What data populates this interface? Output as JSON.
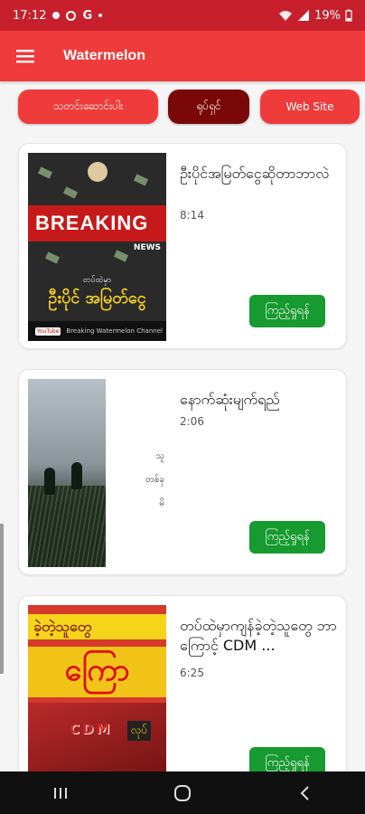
{
  "status_bar": {
    "time": "17:12",
    "battery": "19%",
    "icons": [
      "messenger-icon",
      "ring-icon",
      "google-icon",
      "notification-dot-icon",
      "wifi-icon",
      "signal-icon",
      "battery-icon"
    ]
  },
  "app_bar": {
    "title": "Watermelon",
    "menu_icon": "hamburger-menu-icon"
  },
  "chips": [
    {
      "label": "သတင်းဆောင်းပါး",
      "selected": false
    },
    {
      "label": "ရုပ်ရှင်",
      "selected": true
    },
    {
      "label": "Web Site",
      "selected": false
    }
  ],
  "videos": [
    {
      "title": "ဦးပိုင်အမြတ်ငွေဆိုတာဘာလဲ",
      "duration": "8:14",
      "button": "ကြည့်ရှုရန်",
      "thumb": {
        "headline": "BREAKING",
        "news_tag": "NEWS",
        "subtitle": "တပ်ထဲမှာ",
        "main_text": "ဦးပိုင် အမြတ်ငွေ",
        "footer_logo": "YouTube",
        "footer_text": "Breaking Watermelon Channel"
      }
    },
    {
      "title": "နောက်ဆုံးမျက်ရည်",
      "duration": "2:06",
      "button": "ကြည့်ရှုရန်",
      "thumb": {
        "snippet_lines": [
          "သူ",
          "တစ်ခု",
          "မိ"
        ]
      }
    },
    {
      "title": "တပ်ထဲမှာကျန်ခဲ့တဲ့သူတွေ ဘာကြောင့် CDM ...",
      "duration": "6:25",
      "button": "ကြည့်ရှုရန်",
      "thumb": {
        "top_text": "ခဲ့တဲ့သူတွေ",
        "big_text": "ကြော",
        "cdm_text": "CDM",
        "cdm_box": "လုပ်"
      }
    }
  ],
  "nav_bar": {
    "items": [
      "recent-apps-icon",
      "home-icon",
      "back-icon"
    ]
  },
  "colors": {
    "status_bar": "#c7202c",
    "app_bar": "#ef3b3b",
    "chip_default": "#ef3b3b",
    "chip_selected": "#7a0808",
    "watch_button": "#179a2f"
  }
}
